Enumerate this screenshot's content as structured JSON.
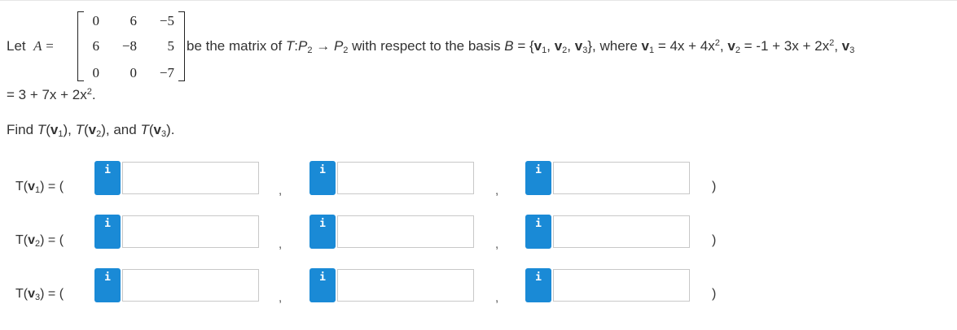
{
  "problem": {
    "let_prefix": "Let",
    "matrix_symbol": "A",
    "equals": "=",
    "matrix": [
      [
        "0",
        "6",
        "−5"
      ],
      [
        "6",
        "−8",
        "5"
      ],
      [
        "0",
        "0",
        "−7"
      ]
    ],
    "desc_1": "be the matrix of",
    "desc_T": "T",
    "desc_colon": ":",
    "desc_P": "P",
    "desc_sub2": "2",
    "desc_arrow": " → ",
    "desc_P2": "P",
    "desc_sub2b": "2",
    "desc_2": " with respect to the basis ",
    "desc_B": "B",
    "desc_3": " = {",
    "v_letter": "v",
    "sub1": "1",
    "sub2": "2",
    "sub3": "3",
    "sep": ", ",
    "desc_4": "}, where ",
    "v1_expr": " = 4x + 4x",
    "v2_expr": " = -1 + 3x + 2x",
    "sq": "2",
    "desc_5": ", ",
    "desc_6": "= 3 + 7x + 2x",
    "desc_end": ".",
    "find_text_1": "Find ",
    "find_text_2": ", and ",
    "find_text_end": "."
  },
  "answers": {
    "rows": [
      {
        "label_T": "T(",
        "label_v": "v",
        "sub": "1",
        "label_end": ") = ("
      },
      {
        "label_T": "T(",
        "label_v": "v",
        "sub": "2",
        "label_end": ") = ("
      },
      {
        "label_T": "T(",
        "label_v": "v",
        "sub": "3",
        "label_end": ") = ("
      }
    ],
    "info_icon": "i",
    "comma": ",",
    "close_paren": ")"
  }
}
